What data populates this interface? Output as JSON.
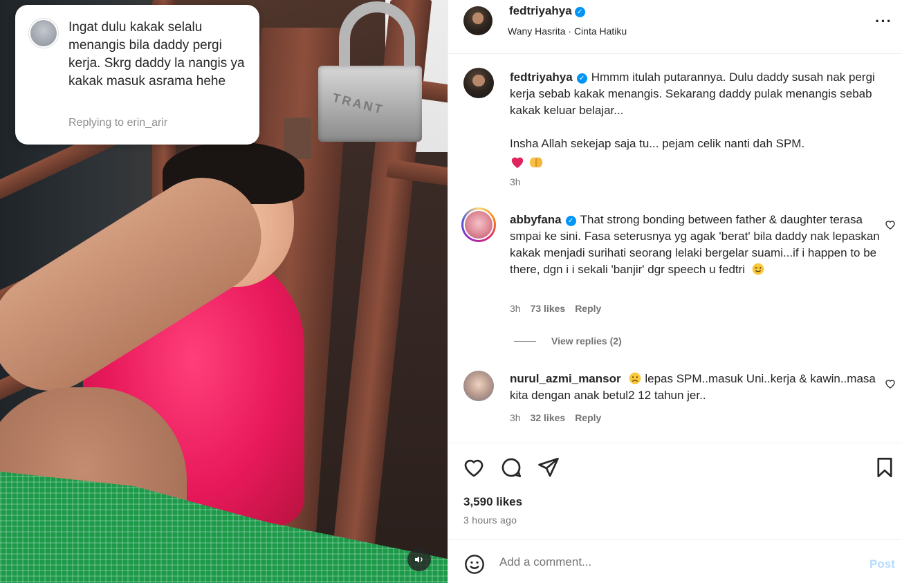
{
  "media": {
    "reply_bubble": {
      "text": "Ingat dulu kakak selalu menangis bila daddy pergi kerja. Skrg daddy la nangis ya kakak masuk asrama hehe",
      "replying_to": "Replying to erin_arir"
    },
    "lock_engraving": "TRANT",
    "audio_icon": "speaker-icon"
  },
  "post": {
    "header": {
      "username": "fedtriyahya",
      "verified": true,
      "subtitle": "Wany Hasrita · Cinta Hatiku",
      "more_label": "···"
    },
    "comments": [
      {
        "username": "fedtriyahya",
        "verified": true,
        "text_line1": "Hmmm itulah putarannya. Dulu daddy susah nak pergi kerja sebab kakak menangis. Sekarang daddy pulak menangis sebab kakak keluar belajar...",
        "text_line2": "Insha Allah sekejap saja tu... pejam celik nanti dah SPM.",
        "emojis": [
          "red-heart",
          "praying-hands"
        ],
        "time": "3h"
      },
      {
        "username": "abbyfana",
        "verified": true,
        "text": "That strong bonding between father & daughter terasa smpai ke sini. Fasa seterusnya yg agak 'berat' bila daddy nak lepaskan kakak menjadi surihati seorang lelaki bergelar suami...if i happen to be there, dgn i i sekali 'banjir' dgr speech u fedtri",
        "emoji": "wink-face",
        "time": "3h",
        "likes": "73 likes",
        "reply_label": "Reply",
        "view_replies": "View replies (2)"
      },
      {
        "username": "nurul_azmi_mansor",
        "verified": false,
        "emoji": "sad-face",
        "text": "lepas SPM..masuk Uni..kerja & kawin..masa kita dengan anak betul2 12 tahun jer..",
        "time": "3h",
        "likes": "32 likes",
        "reply_label": "Reply"
      }
    ],
    "actions": {
      "likes": "3,590 likes",
      "time_ago": "3 hours ago"
    },
    "add_comment": {
      "placeholder": "Add a comment...",
      "post_label": "Post"
    }
  },
  "colors": {
    "verified": "#0095f6",
    "post_disabled": "#b3dbff",
    "muted": "#737373",
    "text": "#262626"
  }
}
